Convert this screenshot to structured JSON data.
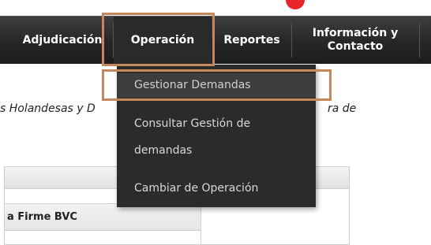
{
  "nav": {
    "items": [
      {
        "label": "Adjudicación"
      },
      {
        "label": "Operación"
      },
      {
        "label": "Reportes"
      },
      {
        "label_line1": "Información y",
        "label_line2": "Contacto"
      }
    ],
    "active": "Operación"
  },
  "dropdown": {
    "items": [
      {
        "label": "Gestionar Demandas"
      },
      {
        "label_line1": "Consultar Gestión de",
        "label_line2": "demandas"
      },
      {
        "label": "Cambiar de Operación"
      }
    ]
  },
  "content": {
    "text_left": "s Holandesas y D",
    "text_right": "ra de"
  },
  "panel": {
    "subpanel_title": "a Firme BVC"
  },
  "colors": {
    "navbar": "#262626",
    "dropdown": "#2b2b2b",
    "highlight_box": "#c8865c",
    "badge": "#e8262a"
  }
}
